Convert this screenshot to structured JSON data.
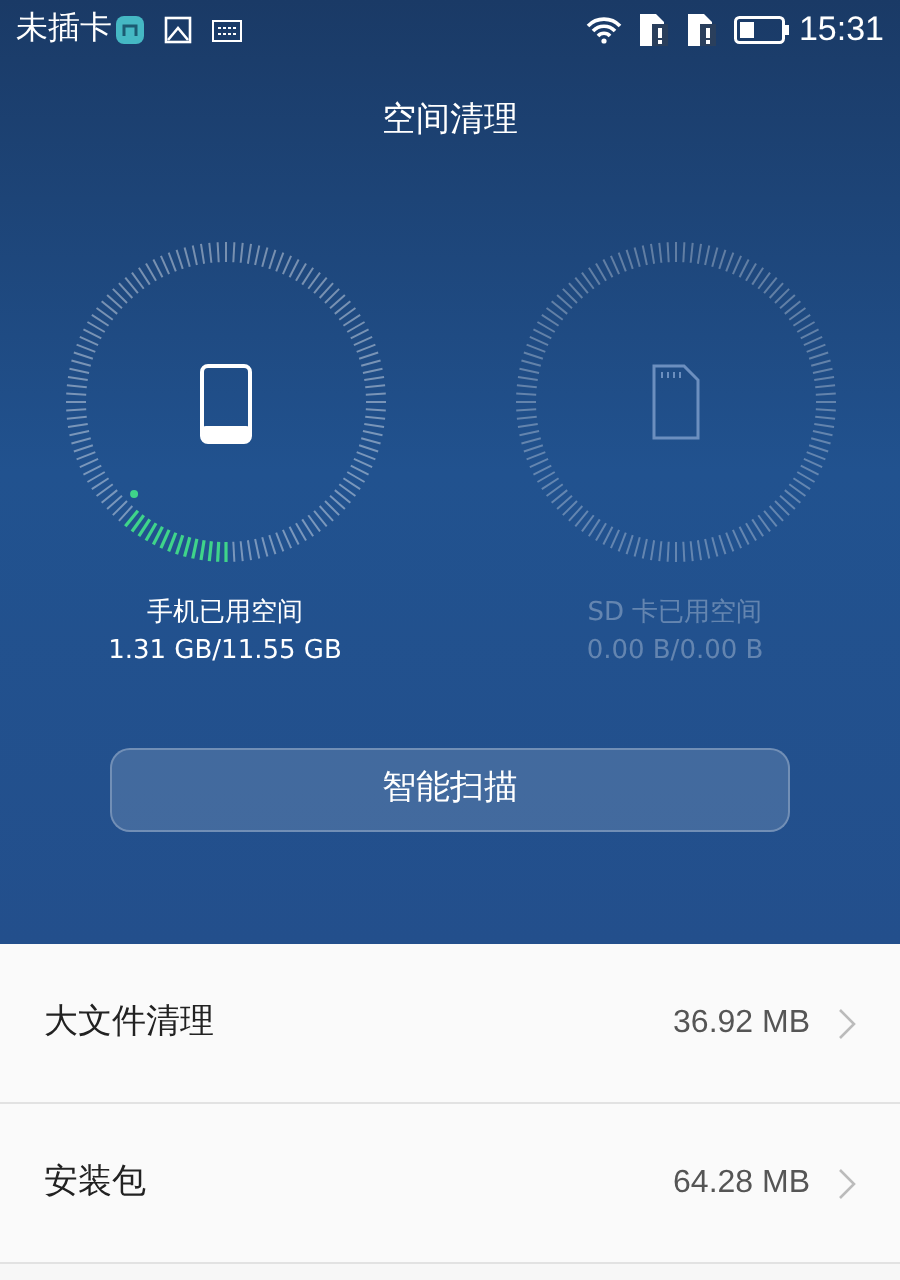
{
  "status_bar": {
    "carrier": "未插卡",
    "time": "15:31"
  },
  "title": "空间清理",
  "gauges": [
    {
      "kind": "phone",
      "label": "手机已用空间",
      "reading": "1.31 GB/11.55 GB",
      "disabled": false
    },
    {
      "kind": "sd",
      "label": "SD 卡已用空间",
      "reading": "0.00 B/0.00 B",
      "disabled": true
    }
  ],
  "scan_button": "智能扫描",
  "items": [
    {
      "label": "大文件清理",
      "size": "36.92 MB"
    },
    {
      "label": "安装包",
      "size": "64.28 MB"
    }
  ]
}
